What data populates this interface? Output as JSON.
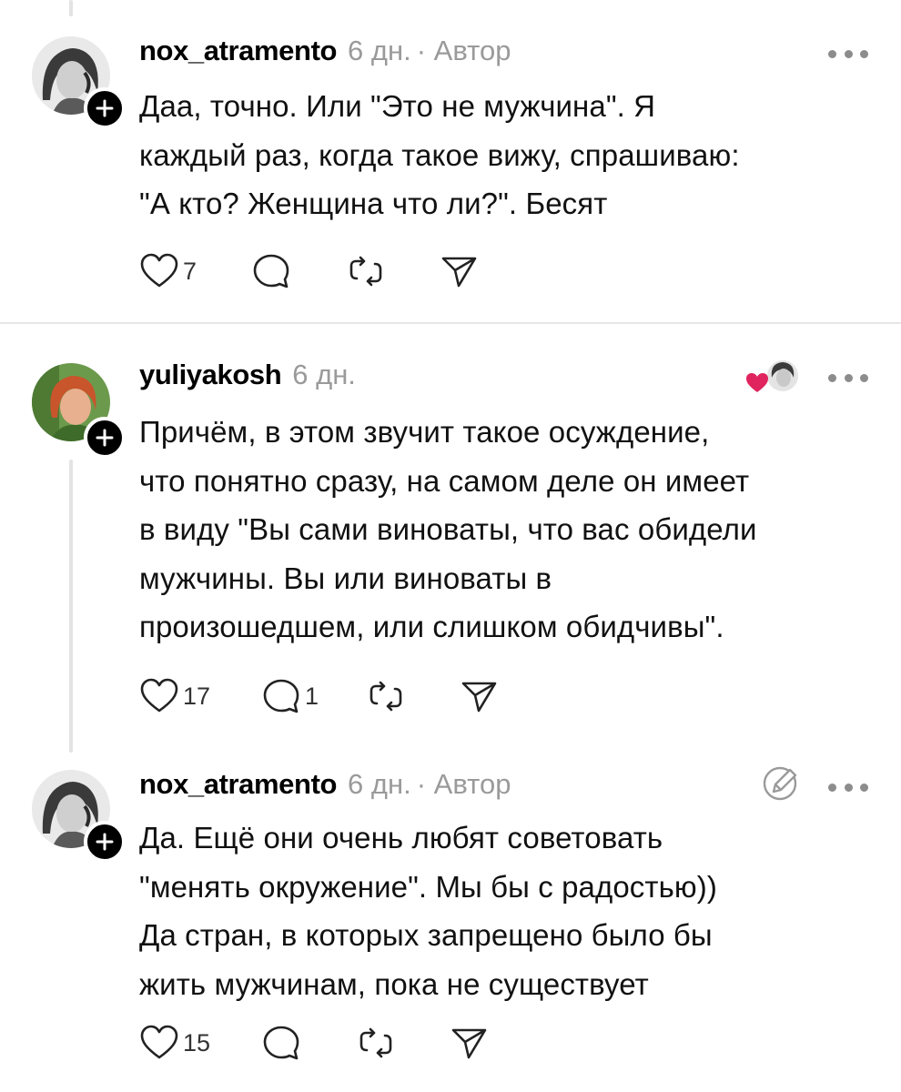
{
  "posts": [
    {
      "username": "nox_atramento",
      "age": "6 дн.",
      "author_tag": " · Автор",
      "text": "Даа, точно. Или \"Это не мужчина\". Я\nкаждый раз, когда такое вижу, спрашиваю:\n\"А кто? Женщина что ли?\". Бесят",
      "likes": "7",
      "replies": "",
      "icons": [
        "heart-icon",
        "comment-icon",
        "repost-icon",
        "share-icon"
      ]
    },
    {
      "username": "yuliyakosh",
      "age": "6 дн.",
      "author_tag": "",
      "text": "Причём, в этом звучит такое осуждение,\nчто понятно сразу, на самом деле он имеет\nв виду \"Вы сами виноваты, что вас обидели\nмужчины. Вы или виноваты в\nпроизошедшем, или слишком обидчивы\".",
      "likes": "17",
      "replies": "1",
      "icons": [
        "heart-icon",
        "comment-icon",
        "repost-icon",
        "share-icon",
        "liked-by-author-icon"
      ]
    },
    {
      "username": "nox_atramento",
      "age": "6 дн.",
      "author_tag": " · Автор",
      "text": "Да. Ещё они очень любят советовать\n\"менять окружение\". Мы бы с радостью))\nДа стран, в которых запрещено было бы\nжить мужчинам, пока не существует",
      "likes": "15",
      "replies": "",
      "icons": [
        "heart-icon",
        "comment-icon",
        "repost-icon",
        "share-icon",
        "edit-icon"
      ]
    }
  ],
  "colors": {
    "text": "#111111",
    "muted": "#9a9a9a",
    "divider": "#e6e6e6",
    "heart_red": "#e0245e"
  }
}
